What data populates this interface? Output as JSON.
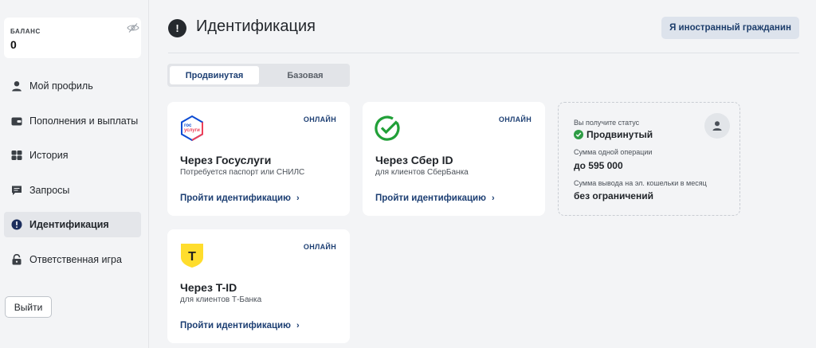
{
  "sidebar": {
    "balance": {
      "label": "БАЛАНС",
      "value": "0"
    },
    "items": [
      {
        "label": "Мой профиль",
        "icon": "user-icon"
      },
      {
        "label": "Пополнения и выплаты",
        "icon": "wallet-icon"
      },
      {
        "label": "История",
        "icon": "history-icon"
      },
      {
        "label": "Запросы",
        "icon": "chat-icon"
      },
      {
        "label": "Идентификация",
        "icon": "exclamation-icon",
        "active": true
      },
      {
        "label": "Ответственная игра",
        "icon": "lock-icon"
      }
    ],
    "logout_label": "Выйти"
  },
  "header": {
    "title": "Идентификация",
    "foreign_button": "Я иностранный гражданин"
  },
  "tabs": [
    {
      "label": "Продвинутая",
      "active": true
    },
    {
      "label": "Базовая",
      "active": false
    }
  ],
  "methods": [
    {
      "title": "Через Госуслуги",
      "desc": "Потребуется паспорт или СНИЛС",
      "badge": "ОНЛАЙН",
      "link": "Пройти идентификацию",
      "logo": "gosuslugi-logo",
      "logo_text": [
        "гос",
        "услуги"
      ]
    },
    {
      "title": "Через Сбер ID",
      "desc": "для клиентов СберБанка",
      "badge": "ОНЛАЙН",
      "link": "Пройти идентификацию",
      "logo": "sber-logo"
    },
    {
      "title": "Через T-ID",
      "desc": "для клиентов Т-Банка",
      "badge": "ОНЛАЙН",
      "link": "Пройти идентификацию",
      "logo": "tbank-logo",
      "logo_text": "Т"
    }
  ],
  "status": {
    "get_status_label": "Вы получите статус",
    "status_value": "Продвинутый",
    "op_limit_label": "Сумма одной операции",
    "op_limit_value": "до 595 000",
    "withdraw_label": "Сумма вывода на эл. кошельки в месяц",
    "withdraw_value": "без ограничений"
  },
  "colors": {
    "accent": "#1d3f73",
    "sber_green": "#21a038",
    "tbank_yellow": "#ffdd2d",
    "gos_blue": "#0d4cd3",
    "gos_red": "#ee3f58"
  }
}
